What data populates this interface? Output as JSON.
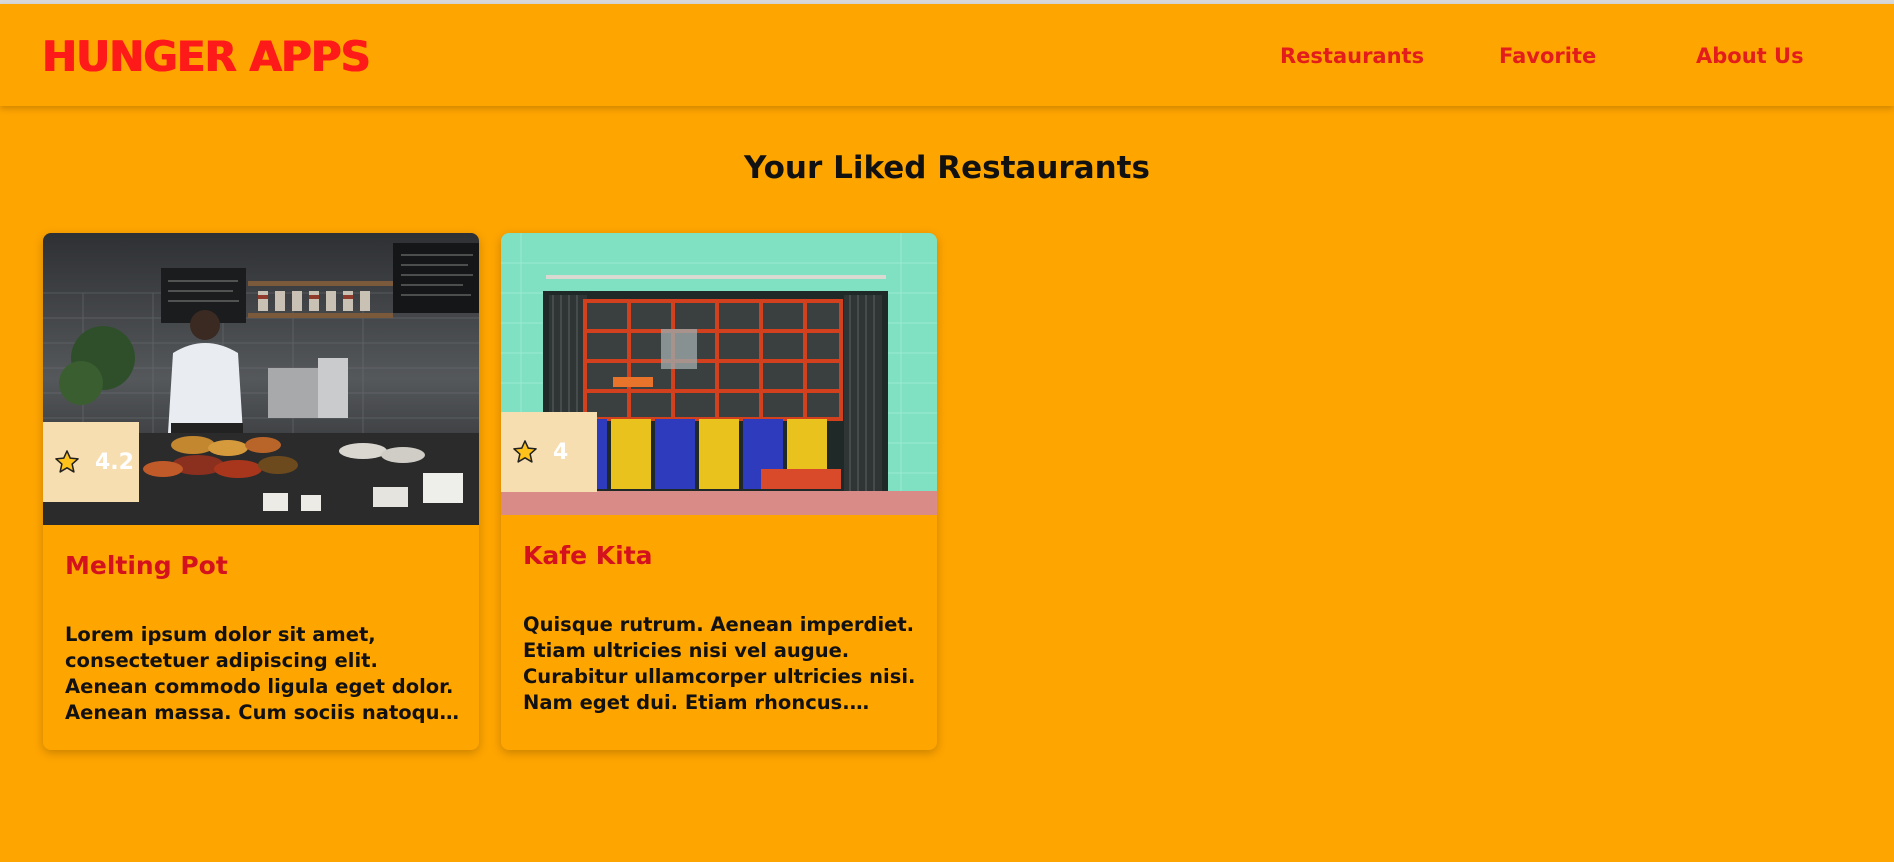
{
  "header": {
    "brand": "HUNGER APPS",
    "nav": [
      {
        "label": "Restaurants"
      },
      {
        "label": "Favorite"
      },
      {
        "label": "About Us"
      }
    ]
  },
  "main": {
    "title": "Your Liked Restaurants",
    "restaurants": [
      {
        "name": "Melting Pot",
        "rating": "4.2",
        "description": "Lorem ipsum dolor sit amet, consectetuer adipiscing elit. Aenean commodo ligula eget dolor. Aenean massa. Cum sociis natoque penatibus et magnis dis parturient montes."
      },
      {
        "name": "Kafe Kita",
        "rating": "4",
        "description": "Quisque rutrum. Aenean imperdiet. Etiam ultricies nisi vel augue. Curabitur ullamcorper ultricies nisi. Nam eget dui. Etiam rhoncus. Maecenas tempus, tellus eget."
      }
    ]
  },
  "colors": {
    "background": "#FFA500",
    "brand": "#FF1A1A",
    "nav": "#E31C1C",
    "card_title": "#D4121E",
    "rating_bg": "#F7DEB1"
  },
  "icons": {
    "rating": "star-icon"
  }
}
